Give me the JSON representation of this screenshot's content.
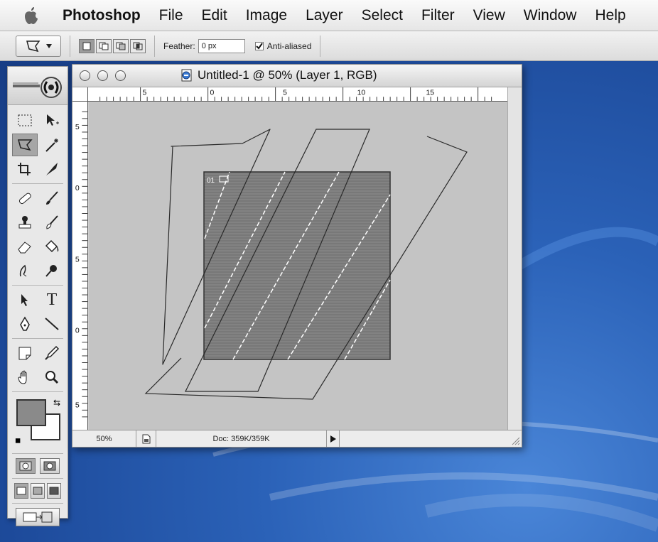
{
  "menubar": {
    "app_name": "Photoshop",
    "items": [
      "File",
      "Edit",
      "Image",
      "Layer",
      "Select",
      "Filter",
      "View",
      "Window",
      "Help"
    ]
  },
  "options_bar": {
    "feather_label": "Feather:",
    "feather_value": "0 px",
    "antialias_label": "Anti-aliased",
    "antialias_checked": true
  },
  "document": {
    "title": "Untitled-1 @ 50% (Layer 1, RGB)",
    "zoom": "50%",
    "doc_size": "Doc: 359K/359K",
    "layer_badge": "01",
    "ruler_h_labels": [
      "5",
      "0",
      "5",
      "10",
      "15"
    ],
    "ruler_v_labels": [
      "5",
      "0",
      "5",
      "0",
      "5"
    ]
  },
  "colors": {
    "foreground": "#8a8a8a",
    "background": "#ffffff",
    "canvas": "#c4c4c4",
    "layer_fill": "#7a7a7a"
  }
}
